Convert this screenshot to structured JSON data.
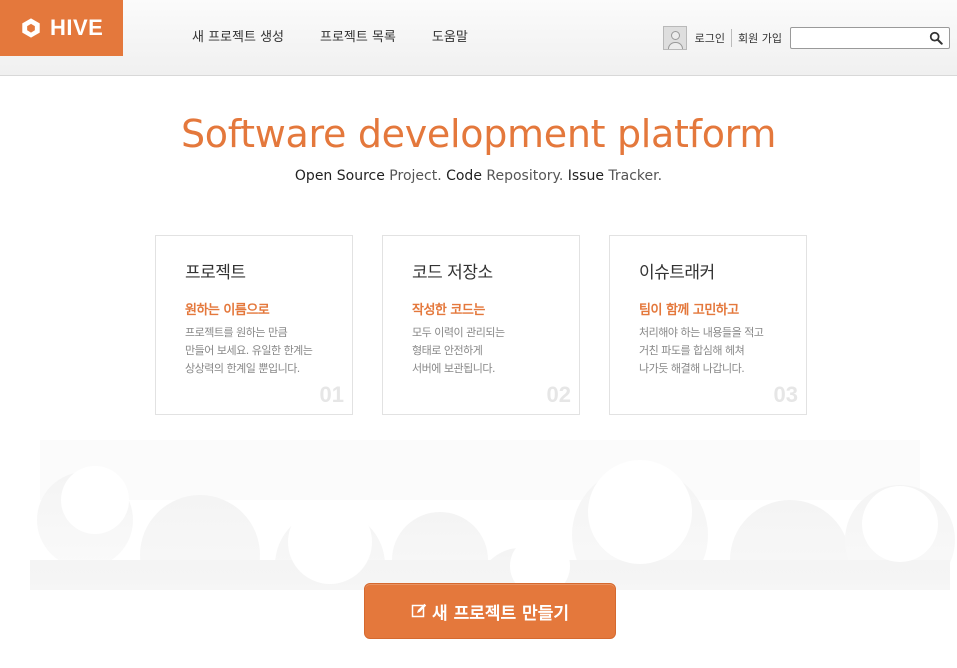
{
  "header": {
    "logo_text": "HIVE",
    "nav": [
      {
        "label": "새 프로젝트 생성"
      },
      {
        "label": "프로젝트 목록"
      },
      {
        "label": "도움말"
      }
    ],
    "login_label": "로그인",
    "signup_label": "회원 가입",
    "search": {
      "value": "",
      "placeholder": ""
    }
  },
  "hero": {
    "title": "Software development platform",
    "subtitle_parts": [
      "Open Source",
      " Project. ",
      "Code",
      " Repository. ",
      "Issue",
      " Tracker."
    ]
  },
  "features": [
    {
      "title": "프로젝트",
      "subtitle": "원하는 이름으로",
      "lines": [
        "프로젝트를 원하는 만큼",
        "만들어 보세요. 유일한 한계는",
        "상상력의 한계일 뿐입니다."
      ],
      "number": "01"
    },
    {
      "title": "코드 저장소",
      "subtitle": "작성한 코드는",
      "lines": [
        "모두 이력이 관리되는",
        "형태로 안전하게",
        "서버에 보관됩니다."
      ],
      "number": "02"
    },
    {
      "title": "이슈트래커",
      "subtitle": "팀이 함께 고민하고",
      "lines": [
        "처리해야 하는 내용들을 적고",
        "거친 파도를 합심해 헤쳐",
        "나가듯 해결해 나갑니다."
      ],
      "number": "03"
    }
  ],
  "cta": {
    "label": "새 프로젝트 만들기"
  },
  "colors": {
    "accent": "#e4783c"
  }
}
